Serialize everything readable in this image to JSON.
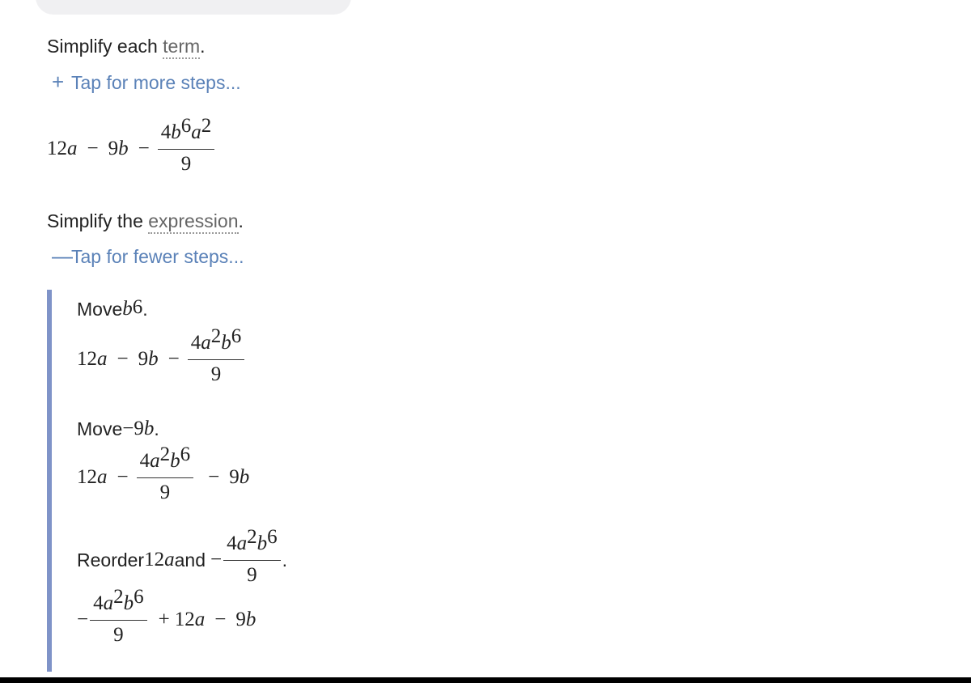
{
  "step1": {
    "prefix": "Simplify each ",
    "link": "term",
    "suffix": ".",
    "tap_symbol": "+",
    "tap_label": "Tap for more steps..."
  },
  "result1": {
    "a": "12",
    "av": "a",
    "m1": "−",
    "b": "9",
    "bv": "b",
    "m2": "−",
    "num_c": "4",
    "num_v1": "b",
    "num_e1": "6",
    "num_v2": "a",
    "num_e2": "2",
    "den": "9"
  },
  "step2": {
    "prefix": "Simplify the ",
    "link": "expression",
    "suffix": ".",
    "tap_symbol": "—",
    "tap_label": "Tap for fewer steps..."
  },
  "sub1": {
    "label": "Move ",
    "var": "b",
    "exp": "6",
    "dot": ".",
    "a": "12",
    "av": "a",
    "m1": "−",
    "b": "9",
    "bv": "b",
    "m2": "−",
    "num_c": "4",
    "num_v1": "a",
    "num_e1": "2",
    "num_v2": "b",
    "num_e2": "6",
    "den": "9"
  },
  "sub2": {
    "label": "Move ",
    "neg": "−9",
    "var": "b",
    "dot": ".",
    "a": "12",
    "av": "a",
    "m1": "−",
    "num_c": "4",
    "num_v1": "a",
    "num_e1": "2",
    "num_v2": "b",
    "num_e2": "6",
    "den": "9",
    "m2": "−",
    "b": "9",
    "bv": "b"
  },
  "sub3": {
    "label": "Reorder ",
    "a": "12",
    "av": "a",
    "and": " and ",
    "neg": "−",
    "num_c": "4",
    "num_v1": "a",
    "num_e1": "2",
    "num_v2": "b",
    "num_e2": "6",
    "den": "9",
    "dot": ".",
    "r_neg": "−",
    "r_num_c": "4",
    "r_num_v1": "a",
    "r_num_e1": "2",
    "r_num_v2": "b",
    "r_num_e2": "6",
    "r_den": "9",
    "r_plus": "+",
    "r_a": "12",
    "r_av": "a",
    "r_minus": "−",
    "r_b": "9",
    "r_bv": "b"
  }
}
